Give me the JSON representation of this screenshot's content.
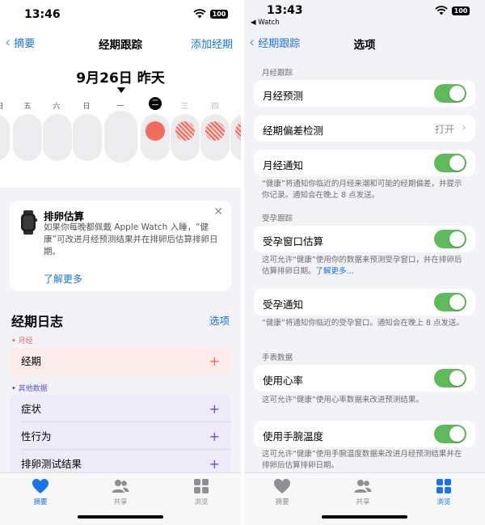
{
  "left": {
    "status": {
      "time": "13:46",
      "battery": "100"
    },
    "nav": {
      "back_label": "摘要",
      "title": "经期跟踪",
      "action_label": "添加经期"
    },
    "calendar": {
      "date_header": "9月26日 昨天",
      "weekdays": [
        "日",
        "五",
        "六",
        "日",
        "一",
        "二",
        "三",
        "四"
      ]
    },
    "watch_card": {
      "title": "排卵估算",
      "body": "如果你每晚都佩戴 Apple Watch 入睡，“健康”可改进月经预测结果并在排卵后估算排卵日期。",
      "learn_more": "了解更多"
    },
    "log": {
      "title": "经期日志",
      "options_label": "选项",
      "period_section": "月经",
      "period_row": "经期",
      "other_section": "其他数据",
      "other_rows": [
        "症状",
        "性行为",
        "排卵测试结果"
      ],
      "plus": "+"
    },
    "tabs": [
      {
        "label": "摘要",
        "icon": "heart-icon",
        "active": true
      },
      {
        "label": "共享",
        "icon": "people-icon",
        "active": false
      },
      {
        "label": "浏览",
        "icon": "grid-icon",
        "active": false
      }
    ]
  },
  "right": {
    "status": {
      "time": "13:43",
      "battery": "100",
      "back_app": "◀ Watch"
    },
    "nav": {
      "back_label": "经期跟踪",
      "title": "选项"
    },
    "sections": {
      "period": "月经跟踪",
      "fertility": "受孕跟踪",
      "watch": "手表数据"
    },
    "rows": {
      "prediction": "月经预测",
      "deviation": "经期偏差检测",
      "deviation_value": "打开",
      "notification": "月经通知",
      "fertile_window": "受孕窗口估算",
      "fertility_notification": "受孕通知",
      "heart_rate": "使用心率",
      "wrist_temp": "使用手腕温度"
    },
    "notes": {
      "notification": "“健康”将通知你临近的月经来潮和可能的经期偏差，并提示你记录。通知会在晚上 8 点发送。",
      "fertile_window": "这可允许“健康”使用你的数据来预测受孕窗口，并在排卵后估算排卵日期。",
      "fertile_window_link": "了解更多…",
      "fertility_notification": "“健康”将通知你临近的受孕窗口。通知会在晚上 8 点发送。",
      "heart_rate": "这可允许“健康”使用心率数据来改进预测结果。",
      "wrist_temp": "这可允许“健康”使用手腕温度数据来改进月经预测结果并在排卵后估算排卵日期。"
    },
    "tabs": [
      {
        "label": "摘要",
        "icon": "heart-icon",
        "active": false
      },
      {
        "label": "共享",
        "icon": "people-icon",
        "active": false
      },
      {
        "label": "浏览",
        "icon": "grid-icon",
        "active": true
      }
    ]
  },
  "colors": {
    "accent": "#1a73e8",
    "period": "#f26b5b",
    "toggle_on": "#5fba5b",
    "other_data": "#5856d6"
  }
}
